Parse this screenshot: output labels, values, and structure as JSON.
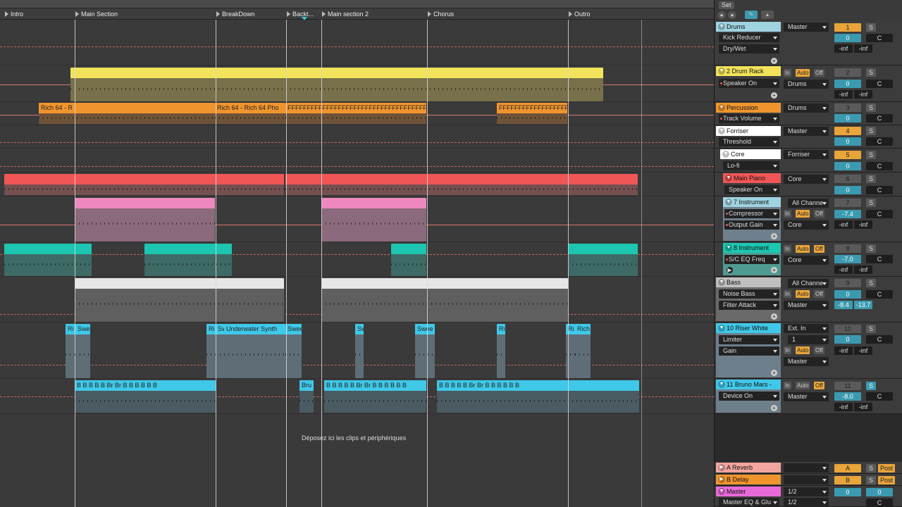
{
  "locators": [
    {
      "label": "Intro"
    },
    {
      "label": "Main Section"
    },
    {
      "label": "BreakDown"
    },
    {
      "label": "Backt..."
    },
    {
      "label": "Main section 2"
    },
    {
      "label": "Chorus"
    },
    {
      "label": "Outro"
    }
  ],
  "clips": {
    "rich": "Rich 64 - R",
    "rich2": "Rich 64 - Rich 64 Pho",
    "fseq": "FFFFFFFFFFFFFFFFFFFFFFFFFFFFFFFFFFFFFFFFFFFFFFFFF",
    "ri": "Ri",
    "swee": "Swee",
    "ri2": "Ri",
    "sw": "Sw",
    "uw": "Underwater Synth",
    "swee2": "Swee",
    "sw3": "Sw",
    "sweep": "Swee",
    "ri3": "Ri",
    "rich3": "Rich",
    "ri4": "Ri",
    "bfrag": "B B B B B Br Br B B B B B B",
    "bru": "Bru"
  },
  "drop_text": "Déposez ici les clips et périphériques",
  "colors": {
    "yellow": "#f2e35a",
    "orange": "#f0952e",
    "red": "#f05656",
    "pink": "#ef88c0",
    "teal": "#1cc6b0",
    "white": "#e6e6e6",
    "cyan": "#3fc8e8",
    "salmon": "#f3a5a0",
    "magenta": "#e86ad8"
  },
  "mixer": {
    "set_label": "Set",
    "tracks": [
      {
        "name": "Drums",
        "route": "Master",
        "num": "1",
        "s": "S",
        "vol": "0",
        "pan": "C",
        "inf1": "-inf",
        "inf2": "-inf",
        "dev1": "Kick Reducer",
        "dev2": "Dry/Wet"
      },
      {
        "name": "2 Drum Rack",
        "in": "In",
        "auto": "Auto",
        "off": "Off",
        "num": "2",
        "s": "S",
        "dev1": "Speaker On",
        "route": "Drums",
        "vol": "0",
        "pan": "C",
        "inf1": "-inf",
        "inf2": "-inf"
      },
      {
        "name": "Percussion",
        "route": "Drums",
        "num": "3",
        "s": "S",
        "dev1": "Track Volume",
        "vol": "0",
        "pan": "C"
      },
      {
        "name": "Forriser",
        "route": "Master",
        "num": "4",
        "s": "S",
        "dev1": "Threshold",
        "vol": "0",
        "pan": "C"
      },
      {
        "name": "Core",
        "route": "Forriser",
        "num": "5",
        "s": "S",
        "dev1": "Lo-fi",
        "vol": "0",
        "pan": "C"
      },
      {
        "name": "Main Piano",
        "route": "Core",
        "num": "6",
        "s": "S",
        "dev1": "Speaker On",
        "vol": "0",
        "pan": "C"
      },
      {
        "name": "7 Instrument",
        "route": "All Channe",
        "num": "7",
        "s": "S",
        "dev1": "Compressor",
        "in": "In",
        "auto": "Auto",
        "off": "Off",
        "vol": "-7.4",
        "pan": "C",
        "dev2": "Output Gain",
        "route2": "Core",
        "inf1": "-inf",
        "inf2": "-inf"
      },
      {
        "name": "8 Instrument",
        "in": "In",
        "auto": "Auto",
        "off": "Off",
        "num": "8",
        "s": "S",
        "dev1": "S/C EQ Freq",
        "route": "Core",
        "vol": "-7.0",
        "pan": "C",
        "inf1": "-inf",
        "inf2": "-inf"
      },
      {
        "name": "Bass",
        "route": "All Channe",
        "num": "9",
        "s": "S",
        "dev1": "Noise Bass",
        "in": "In",
        "auto": "Auto",
        "off": "Off",
        "vol": "0",
        "pan": "C",
        "dev2": "Filter Attack",
        "route2": "Master",
        "sa": "-8.4",
        "sb": "-13.7"
      },
      {
        "name": "10 Riser White",
        "route": "Ext. In",
        "num": "10",
        "s": "S",
        "dev1": "Limiter",
        "ch": "1",
        "vol": "0",
        "pan": "C",
        "dev2": "Gain",
        "in": "In",
        "auto": "Auto",
        "off": "Off",
        "route2": "Master",
        "inf1": "-inf",
        "inf2": "-inf"
      },
      {
        "name": "11 Bruno Mars -",
        "in": "In",
        "auto": "Auto",
        "off": "Off",
        "num": "11",
        "s": "S",
        "dev1": "Device On",
        "route": "Master",
        "vol": "-8.0",
        "pan": "C",
        "inf1": "-inf",
        "inf2": "-inf"
      }
    ],
    "returns": [
      {
        "name": "A Reverb",
        "letter": "A",
        "s": "S",
        "post": "Post"
      },
      {
        "name": "B Delay",
        "letter": "B",
        "s": "S",
        "post": "Post"
      },
      {
        "name": "Master",
        "route": "1/2",
        "vol": "0",
        "sv": "0"
      }
    ],
    "master_dev": "Master EQ & Glu",
    "master_route2": "1/2",
    "master_pan": "C"
  }
}
